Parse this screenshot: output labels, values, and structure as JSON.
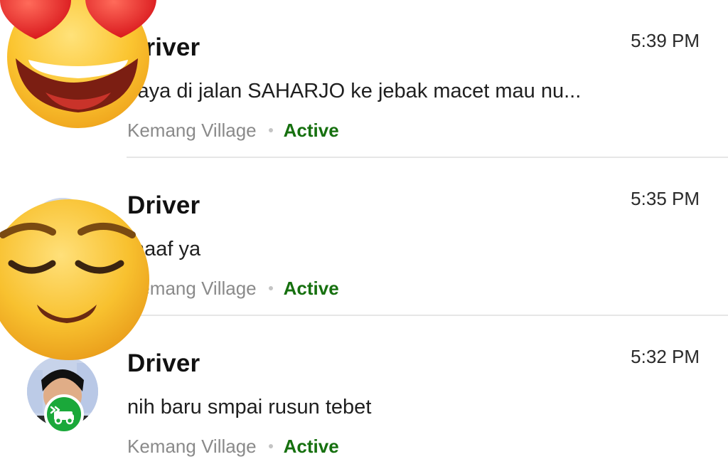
{
  "chats": [
    {
      "name": "Driver",
      "time": "5:39 PM",
      "message": "saya di jalan SAHARJO ke jebak macet mau nu...",
      "location": "Kemang Village",
      "status": "Active"
    },
    {
      "name": "Driver",
      "time": "5:35 PM",
      "message": "maaf ya",
      "location": "Kemang Village",
      "status": "Active"
    },
    {
      "name": "Driver",
      "time": "5:32 PM",
      "message": "nih baru smpai rusun tebet",
      "location": "Kemang Village",
      "status": "Active"
    }
  ],
  "colors": {
    "status_active": "#16700f",
    "badge": "#1aa83a",
    "divider": "#e6e6e6"
  },
  "icons": {
    "avatar": "driver-avatar-photo",
    "badge": "car-badge-icon",
    "sticker_1": "heart-eyes-emoji",
    "sticker_2": "relieved-face-emoji"
  }
}
